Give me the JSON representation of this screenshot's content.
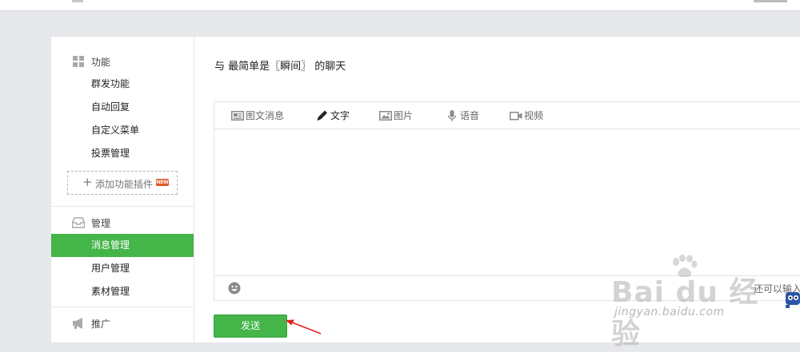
{
  "colors": {
    "accent": "#44b549",
    "badge": "#e05a28",
    "annotation": "#e02020"
  },
  "sidebar": {
    "sections": [
      {
        "title": "功能",
        "icon": "grid-icon",
        "items": [
          {
            "label": "群发功能"
          },
          {
            "label": "自动回复"
          },
          {
            "label": "自定义菜单"
          },
          {
            "label": "投票管理"
          }
        ]
      },
      {
        "title": "管理",
        "icon": "inbox-icon",
        "items": [
          {
            "label": "消息管理",
            "active": true
          },
          {
            "label": "用户管理"
          },
          {
            "label": "素材管理"
          }
        ]
      },
      {
        "title": "推广",
        "icon": "megaphone-icon",
        "items": []
      }
    ],
    "add_plugin_label": "添加功能插件",
    "new_badge": "NEW"
  },
  "main": {
    "title": "与 最简单是〖瞬间〗 的聊天",
    "tabs": [
      {
        "label": "图文消息",
        "icon": "article-icon"
      },
      {
        "label": "文字",
        "icon": "pencil-icon",
        "selected": true
      },
      {
        "label": "图片",
        "icon": "image-icon"
      },
      {
        "label": "语音",
        "icon": "microphone-icon"
      },
      {
        "label": "视频",
        "icon": "video-icon"
      }
    ],
    "message_value": "",
    "counter_text": "还可以输入",
    "send_label": "发送"
  },
  "watermark": {
    "logo": "Bai du 经验",
    "url": "jingyan.baidu.com"
  }
}
